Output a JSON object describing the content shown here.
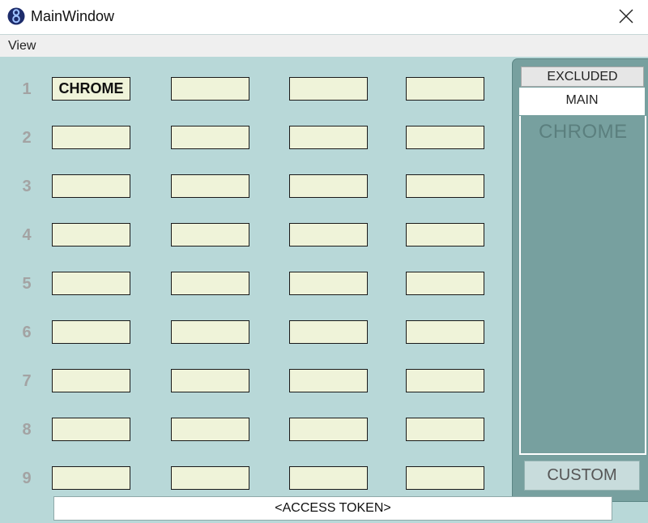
{
  "window": {
    "title": "MainWindow",
    "app_icon": "app-logo-icon",
    "close_icon": "close-icon"
  },
  "menu": {
    "view_label": "View"
  },
  "grid": {
    "row_labels": [
      "1",
      "2",
      "3",
      "4",
      "5",
      "6",
      "7",
      "8",
      "9"
    ],
    "slots": [
      [
        "CHROME",
        "",
        "",
        ""
      ],
      [
        "",
        "",
        "",
        ""
      ],
      [
        "",
        "",
        "",
        ""
      ],
      [
        "",
        "",
        "",
        ""
      ],
      [
        "",
        "",
        "",
        ""
      ],
      [
        "",
        "",
        "",
        ""
      ],
      [
        "",
        "",
        "",
        ""
      ],
      [
        "",
        "",
        "",
        ""
      ],
      [
        "",
        "",
        "",
        ""
      ]
    ]
  },
  "panel": {
    "tabs": [
      "EXCLUDED",
      "MAIN"
    ],
    "active_tab": "MAIN",
    "items": [
      "CHROME"
    ],
    "custom_label": "CUSTOM"
  },
  "token": {
    "text": "<ACCESS TOKEN>"
  },
  "colors": {
    "background": "#b8d8d8",
    "slot_fill": "#eff3d9",
    "panel": "#77a09f"
  }
}
